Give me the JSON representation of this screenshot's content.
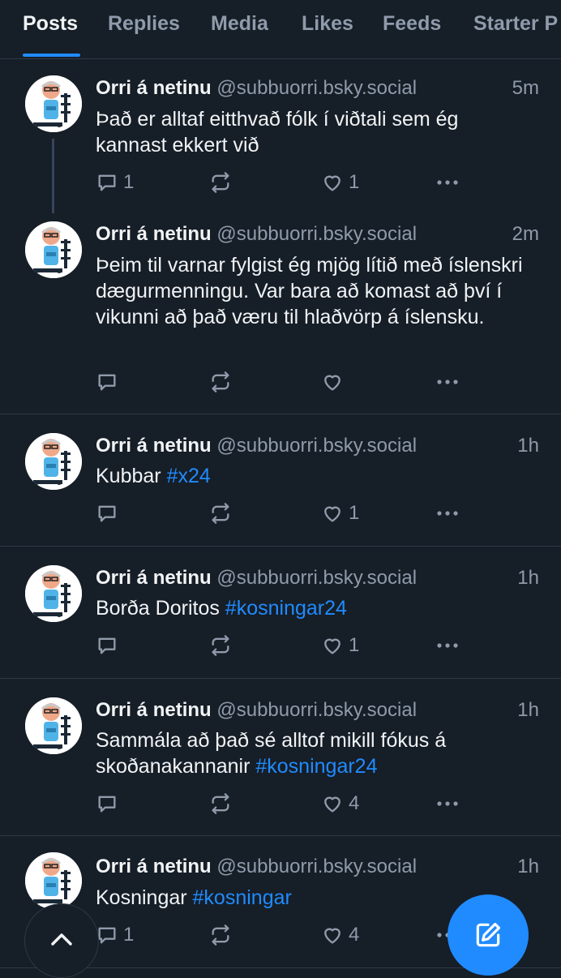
{
  "tabs": [
    {
      "label": "Posts",
      "active": true
    },
    {
      "label": "Replies"
    },
    {
      "label": "Media"
    },
    {
      "label": "Likes"
    },
    {
      "label": "Feeds"
    },
    {
      "label": "Starter P"
    }
  ],
  "posts": [
    {
      "author": "Orri á netinu",
      "handle": "@subbuorri.bsky.social",
      "time": "5m",
      "text": "Það er alltaf eitthvað fólk í viðtali sem ég kannast ekkert við",
      "hashtag": "",
      "reply_count": "1",
      "like_count": "1"
    },
    {
      "author": "Orri á netinu",
      "handle": "@subbuorri.bsky.social",
      "time": "2m",
      "text": "Þeim til varnar fylgist ég mjög lítið með íslenskri dægurmenningu. Var bara að komast að því í vikunni að það væru til hlaðvörp á íslensku.",
      "hashtag": "",
      "reply_count": "",
      "like_count": ""
    },
    {
      "author": "Orri á netinu",
      "handle": "@subbuorri.bsky.social",
      "time": "1h",
      "text": "Kubbar ",
      "hashtag": "#x24",
      "reply_count": "",
      "like_count": "1"
    },
    {
      "author": "Orri á netinu",
      "handle": "@subbuorri.bsky.social",
      "time": "1h",
      "text": "Borða Doritos ",
      "hashtag": "#kosningar24",
      "reply_count": "",
      "like_count": "1"
    },
    {
      "author": "Orri á netinu",
      "handle": "@subbuorri.bsky.social",
      "time": "1h",
      "text": "Sammála að það sé alltof mikill fókus á skoðanakannanir ",
      "hashtag": "#kosningar24",
      "reply_count": "",
      "like_count": "4"
    },
    {
      "author": "Orri á netinu",
      "handle": "@subbuorri.bsky.social",
      "time": "1h",
      "text": "Kosningar ",
      "hashtag": "#kosningar",
      "reply_count": "1",
      "like_count": "4"
    }
  ],
  "icons": {
    "reply": "reply-icon",
    "repost": "repost-icon",
    "like": "heart-icon",
    "more": "more-icon",
    "scroll_top": "chevron-up-icon",
    "compose": "compose-icon"
  },
  "colors": {
    "background": "#161e27",
    "accent": "#208bfe",
    "muted": "#8f9bab",
    "divider": "#2e3a48"
  }
}
